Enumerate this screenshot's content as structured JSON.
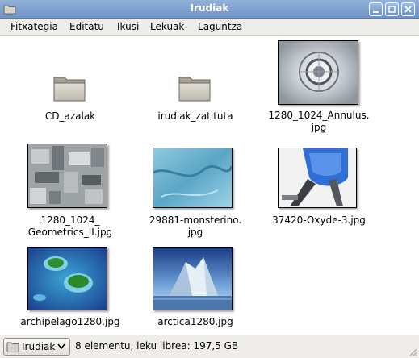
{
  "window": {
    "title": "Irudiak"
  },
  "menu": [
    {
      "label": "Fitxategia"
    },
    {
      "label": "Editatu"
    },
    {
      "label": "Ikusi"
    },
    {
      "label": "Lekuak"
    },
    {
      "label": "Laguntza"
    }
  ],
  "items": [
    {
      "label": "CD_azalak",
      "kind": "folder-icon"
    },
    {
      "label": "irudiak_zatituta",
      "kind": "folder-icon"
    },
    {
      "label": "1280_1024_Annulus.\njpg",
      "kind": "thumbnail"
    },
    {
      "label": "1280_1024_\nGeometrics_II.jpg",
      "kind": "thumbnail"
    },
    {
      "label": "29881-monsterino.\njpg",
      "kind": "thumbnail"
    },
    {
      "label": "37420-Oxyde-3.jpg",
      "kind": "thumbnail"
    },
    {
      "label": "archipelago1280.jpg",
      "kind": "thumbnail"
    },
    {
      "label": "arctica1280.jpg",
      "kind": "thumbnail"
    }
  ],
  "statusbar": {
    "location": "Irudiak",
    "info": "8 elementu, leku librea: 197,5 GB"
  }
}
